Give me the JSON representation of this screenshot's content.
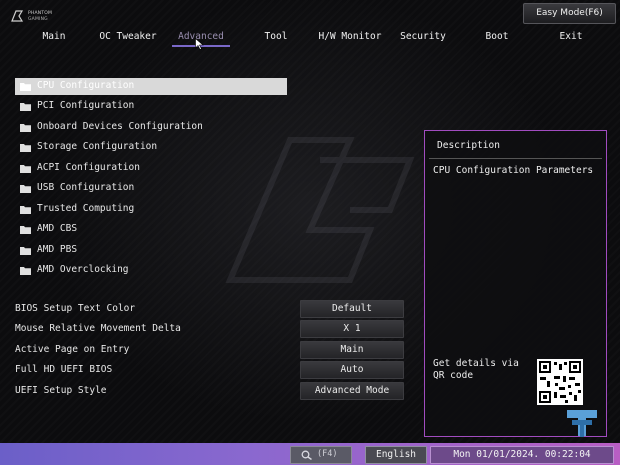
{
  "brand": {
    "line1": "PHANTOM",
    "line2": "GAMING"
  },
  "header": {
    "easy_mode_label": "Easy Mode(F6)"
  },
  "tabs": [
    {
      "label": "Main"
    },
    {
      "label": "OC Tweaker"
    },
    {
      "label": "Advanced",
      "active": true
    },
    {
      "label": "Tool"
    },
    {
      "label": "H/W Monitor"
    },
    {
      "label": "Security"
    },
    {
      "label": "Boot"
    },
    {
      "label": "Exit"
    }
  ],
  "menu": [
    {
      "label": "CPU Configuration",
      "selected": true
    },
    {
      "label": "PCI Configuration"
    },
    {
      "label": "Onboard Devices Configuration"
    },
    {
      "label": "Storage Configuration"
    },
    {
      "label": "ACPI Configuration"
    },
    {
      "label": "USB Configuration"
    },
    {
      "label": "Trusted Computing"
    },
    {
      "label": "AMD CBS"
    },
    {
      "label": "AMD PBS"
    },
    {
      "label": "AMD Overclocking"
    }
  ],
  "settings": [
    {
      "label": "BIOS Setup Text Color",
      "value": "Default"
    },
    {
      "label": "Mouse Relative Movement Delta",
      "value": "X 1"
    },
    {
      "label": "Active Page on Entry",
      "value": "Main"
    },
    {
      "label": "Full HD UEFI BIOS",
      "value": "Auto"
    },
    {
      "label": "UEFI Setup Style",
      "value": "Advanced Mode"
    }
  ],
  "description": {
    "title": "Description",
    "text": "CPU Configuration Parameters",
    "qr_text": "Get details via QR code"
  },
  "bottom_bar": {
    "search_label": "(F4)",
    "language": "English",
    "clock": "Mon 01/01/2024. 00:22:04"
  },
  "colors": {
    "accent": "#7a68c8",
    "panel_border": "#a14cc0",
    "selected_row": "#d9d9d9",
    "bottom_bar_start": "#6b5fc8",
    "bottom_bar_end": "#b85ec4"
  },
  "icons": {
    "brand": "phantom-gaming-logo-icon",
    "menu_item": "folder-icon",
    "search": "search-icon",
    "cursor": "mouse-pointer-icon",
    "corner_logo": "tt-logo-icon"
  }
}
